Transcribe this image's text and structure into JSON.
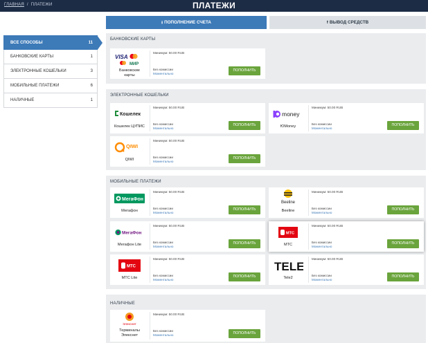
{
  "header": {
    "breadcrumb_home": "ГЛАВНАЯ",
    "breadcrumb_sep": "/",
    "breadcrumb_current": "ПЛАТЕЖИ",
    "title": "ПЛАТЕЖИ"
  },
  "tabs": {
    "deposit": "ПОПОЛНЕНИЕ СЧЕТА",
    "withdraw": "ВЫВОД СРЕДСТВ"
  },
  "sidebar": [
    {
      "label": "ВСЕ СПОСОБЫ",
      "count": "11"
    },
    {
      "label": "БАНКОВСКИЕ КАРТЫ",
      "count": "1"
    },
    {
      "label": "ЭЛЕКТРОННЫЕ КОШЕЛЬКИ",
      "count": "3"
    },
    {
      "label": "МОБИЛЬНЫЕ ПЛАТЕЖИ",
      "count": "6"
    },
    {
      "label": "НАЛИЧНЫЕ",
      "count": "1"
    }
  ],
  "common": {
    "min": "Минимум: 50.00 RUB",
    "fee": "Без комиссии",
    "speed": "Моментально",
    "button": "ПОПОЛНИТЬ"
  },
  "sections": {
    "cards": {
      "title": "БАНКОВСКИЕ КАРТЫ",
      "items": [
        {
          "name": "Банковские карты",
          "logo": "visa-mastercard-mir-logo"
        }
      ]
    },
    "wallets": {
      "title": "ЭЛЕКТРОННЫЕ КОШЕЛЬКИ",
      "items": [
        {
          "name": "Кошелек ЦУПИС",
          "logo": "koshelek-logo",
          "logo_text": "Кошелек"
        },
        {
          "name": "ЮMoney",
          "logo": "yoomoney-logo",
          "logo_text": "money"
        },
        {
          "name": "QIWI",
          "logo": "qiwi-logo",
          "logo_text": "QIWI"
        }
      ]
    },
    "mobile": {
      "title": "МОБИЛЬНЫЕ ПЛАТЕЖИ",
      "items": [
        {
          "name": "Мегафон",
          "logo": "megafon-logo",
          "logo_text": "МегаФон"
        },
        {
          "name": "Beeline",
          "logo": "beeline-logo",
          "logo_text": "Beeline"
        },
        {
          "name": "Мегафон Lite",
          "logo": "megafon-lite-logo",
          "logo_text": "МегаФон"
        },
        {
          "name": "МТС",
          "logo": "mts-logo",
          "logo_text": "МТС"
        },
        {
          "name": "МТС Lite",
          "logo": "mts-lite-logo",
          "logo_text": "МТС"
        },
        {
          "name": "Tele2",
          "logo": "tele2-logo",
          "logo_text": "TELE2"
        }
      ]
    },
    "cash": {
      "title": "НАЛИЧНЫЕ",
      "items": [
        {
          "name": "Терминалы Элекснет",
          "logo": "eleksnet-logo",
          "logo_text": "Элекснет"
        }
      ]
    }
  },
  "colors": {
    "header": "#1d2c45",
    "accent": "#3d7ab8",
    "button": "#6aa43c",
    "section_bg": "#eaecee"
  }
}
